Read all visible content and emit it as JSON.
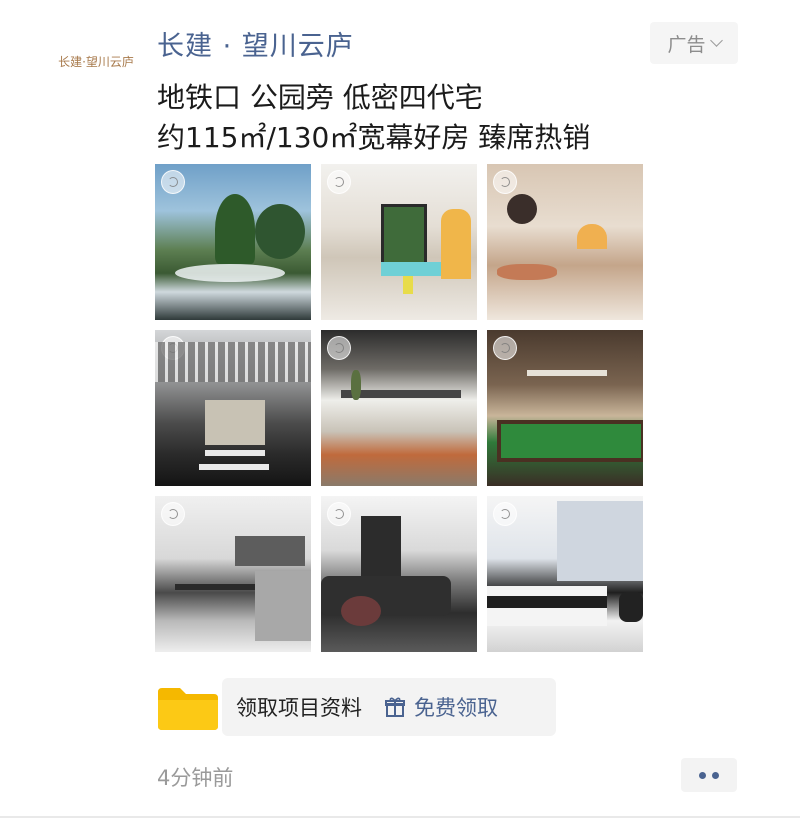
{
  "account": {
    "logo_text": "长建·望川云庐",
    "name": "长建 · 望川云庐"
  },
  "ad": {
    "tag_label": "广告",
    "icon": "chevron-down-icon"
  },
  "headline": {
    "line1": "地铁口 公园旁 低密四代宅",
    "line2": "约115㎡/130㎡宽幕好房 臻席热销"
  },
  "gallery": {
    "images": [
      {
        "label": "landscape-garden"
      },
      {
        "label": "kids-playroom"
      },
      {
        "label": "lounge-play-area"
      },
      {
        "label": "lobby-entrance"
      },
      {
        "label": "tea-room"
      },
      {
        "label": "billiards-room"
      },
      {
        "label": "kitchen-dining"
      },
      {
        "label": "living-room"
      },
      {
        "label": "bedroom"
      }
    ]
  },
  "cta": {
    "label": "领取项目资料",
    "gift_icon": "gift-icon",
    "action_label": "免费领取",
    "folder_icon": "folder-icon"
  },
  "footer": {
    "timestamp": "4分钟前",
    "more_icon": "more-dots-icon"
  },
  "colors": {
    "link_blue": "#4a6390",
    "tag_bg": "#f5f5f5",
    "folder_yellow": "#f5b800"
  }
}
